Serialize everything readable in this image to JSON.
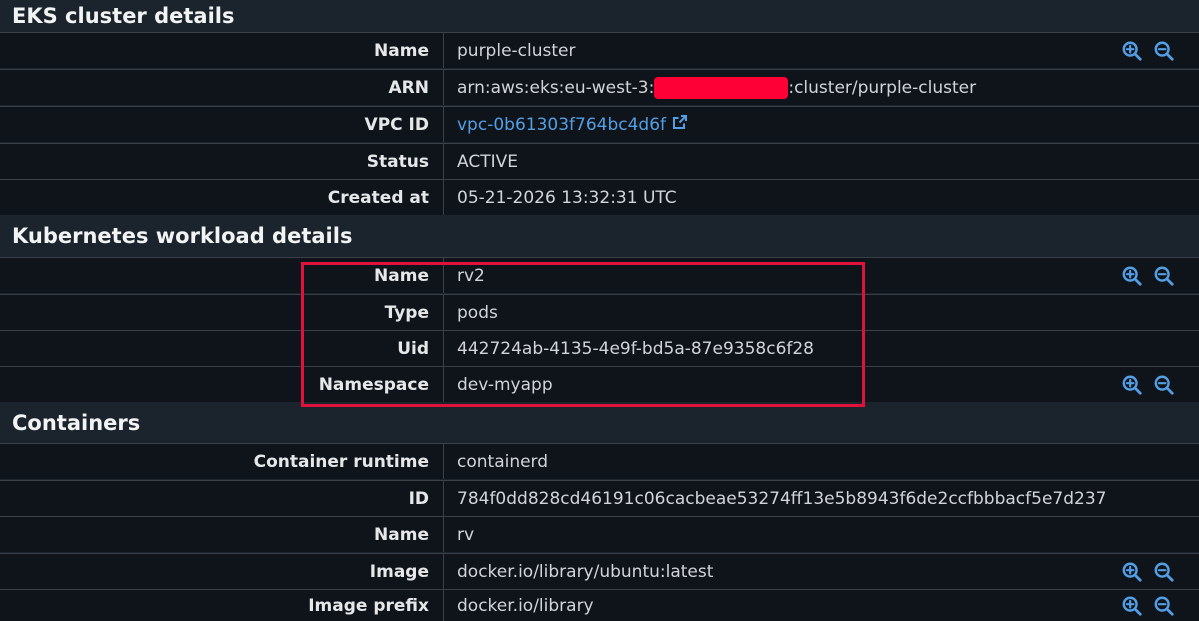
{
  "eks": {
    "title": "EKS cluster details",
    "name_label": "Name",
    "name_value": "purple-cluster",
    "arn_label": "ARN",
    "arn_prefix": "arn:aws:eks:eu-west-3:",
    "arn_suffix": ":cluster/purple-cluster",
    "vpc_label": "VPC ID",
    "vpc_value": "vpc-0b61303f764bc4d6f",
    "status_label": "Status",
    "status_value": "ACTIVE",
    "created_label": "Created at",
    "created_value": "05-21-2026 13:32:31 UTC"
  },
  "k8s": {
    "title": "Kubernetes workload details",
    "name_label": "Name",
    "name_value": "rv2",
    "type_label": "Type",
    "type_value": "pods",
    "uid_label": "Uid",
    "uid_value": "442724ab-4135-4e9f-bd5a-87e9358c6f28",
    "namespace_label": "Namespace",
    "namespace_value": "dev-myapp"
  },
  "containers": {
    "title": "Containers",
    "runtime_label": "Container runtime",
    "runtime_value": "containerd",
    "id_label": "ID",
    "id_value": "784f0dd828cd46191c06cacbeae53274ff13e5b8943f6de2ccfbbbacf5e7d237",
    "name_label": "Name",
    "name_value": "rv",
    "image_label": "Image",
    "image_value": "docker.io/library/ubuntu:latest",
    "image_prefix_label": "Image prefix",
    "image_prefix_value": "docker.io/library"
  },
  "colors": {
    "background": "#1b232d",
    "row_background": "#0f141a",
    "link": "#539fe5",
    "highlight_border": "#e0113d",
    "redaction": "#ff0036"
  },
  "icons": {
    "zoom_in": "zoom-in-icon",
    "zoom_out": "zoom-out-icon",
    "external_link": "external-link-icon"
  }
}
